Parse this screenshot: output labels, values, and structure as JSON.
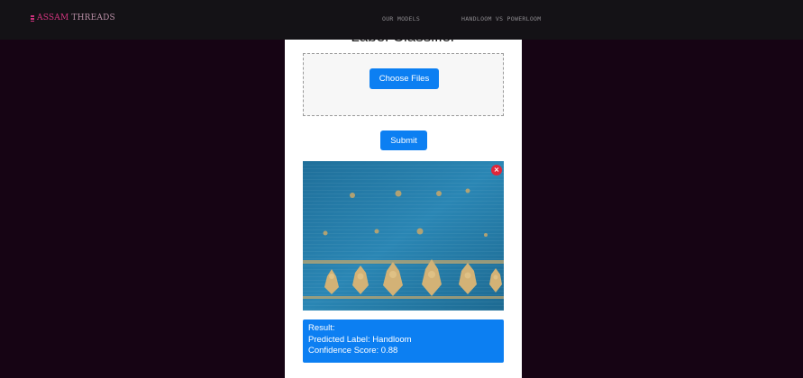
{
  "nav": {
    "logo_part1": "ASSAM",
    "logo_part2": "THREADS",
    "links": [
      "OUR MODELS",
      "HANDLOOM VS POWERLOOM"
    ]
  },
  "modal": {
    "title": "Label Classifier",
    "choose_label": "Choose Files",
    "submit_label": "Submit",
    "remove_label": "×"
  },
  "result": {
    "heading": "Result:",
    "label_line": "Predicted Label: Handloom",
    "score_line": "Confidence Score: 0.88"
  },
  "colors": {
    "accent": "#0c7ff2",
    "background": "#160414",
    "logo": "#d2357f",
    "remove": "#e0263a"
  }
}
